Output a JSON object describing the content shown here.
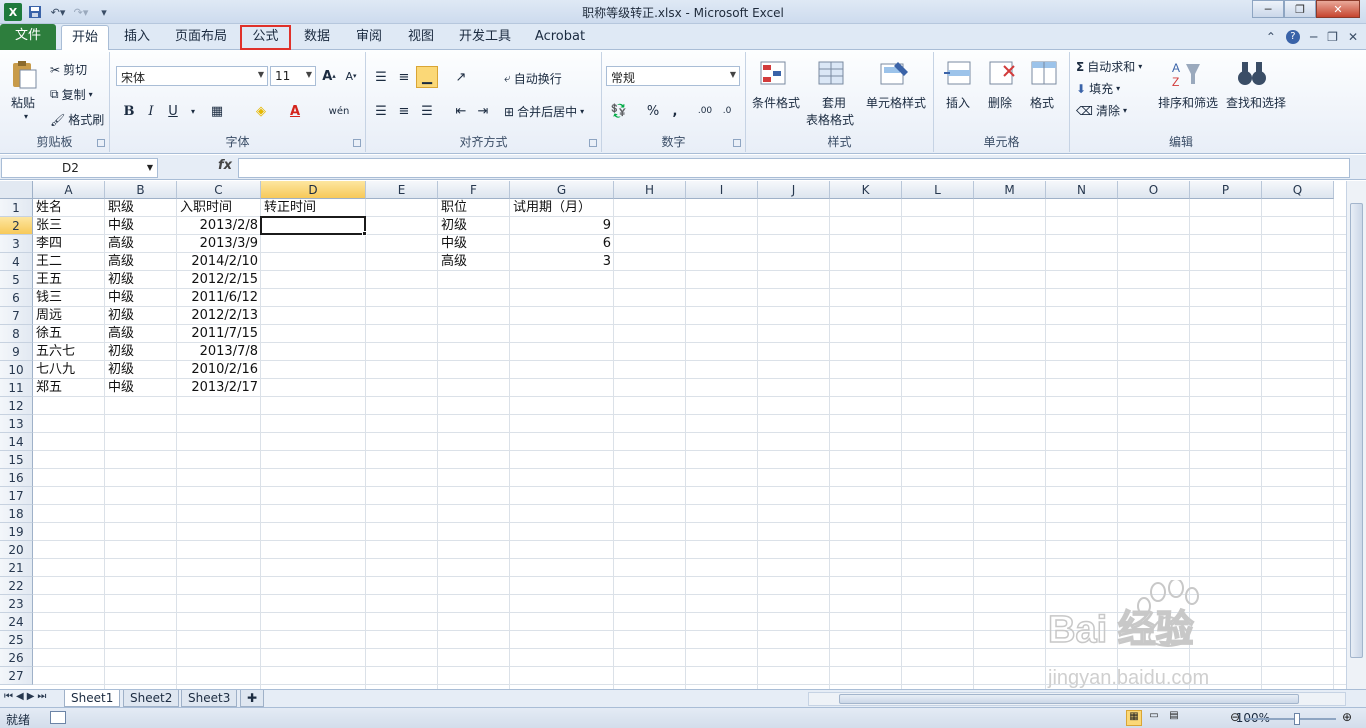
{
  "window": {
    "title": "职称等级转正.xlsx - Microsoft Excel"
  },
  "tabs": [
    "文件",
    "开始",
    "插入",
    "页面布局",
    "公式",
    "数据",
    "审阅",
    "视图",
    "开发工具",
    "Acrobat"
  ],
  "ribbon": {
    "clipboard": {
      "label": "剪贴板",
      "paste": "粘贴",
      "cut": "剪切",
      "copy": "复制",
      "format_painter": "格式刷"
    },
    "font": {
      "label": "字体",
      "name": "宋体",
      "size": "11"
    },
    "alignment": {
      "label": "对齐方式",
      "wrap": "自动换行",
      "merge": "合并后居中"
    },
    "number": {
      "label": "数字",
      "format": "常规"
    },
    "styles": {
      "label": "样式",
      "conditional": "条件格式",
      "table_line1": "套用",
      "table_line2": "表格格式",
      "cell_styles": "单元格样式"
    },
    "cells": {
      "label": "单元格",
      "insert": "插入",
      "delete": "删除",
      "format": "格式"
    },
    "editing": {
      "label": "编辑",
      "autosum": "自动求和",
      "fill": "填充",
      "clear": "清除",
      "sort": "排序和筛选",
      "find": "查找和选择"
    }
  },
  "formula_bar": {
    "name_box": "D2",
    "fx": "fx",
    "value": ""
  },
  "columns": [
    "A",
    "B",
    "C",
    "D",
    "E",
    "F",
    "G",
    "H",
    "I",
    "J",
    "K",
    "L",
    "M",
    "N",
    "O",
    "P",
    "Q"
  ],
  "rows": [
    "1",
    "2",
    "3",
    "4",
    "5",
    "6",
    "7",
    "8",
    "9",
    "10",
    "11",
    "12",
    "13",
    "14",
    "15",
    "16",
    "17",
    "18",
    "19",
    "20",
    "21",
    "22",
    "23",
    "24",
    "25",
    "26",
    "27"
  ],
  "table": {
    "headers": [
      "姓名",
      "职级",
      "入职时间",
      "转正时间"
    ],
    "records": [
      {
        "name": "张三",
        "level": "中级",
        "date": "2013/2/8"
      },
      {
        "name": "李四",
        "level": "高级",
        "date": "2013/3/9"
      },
      {
        "name": "王二",
        "level": "高级",
        "date": "2014/2/10"
      },
      {
        "name": "王五",
        "level": "初级",
        "date": "2012/2/15"
      },
      {
        "name": "钱三",
        "level": "中级",
        "date": "2011/6/12"
      },
      {
        "name": "周远",
        "level": "初级",
        "date": "2012/2/13"
      },
      {
        "name": "徐五",
        "level": "高级",
        "date": "2011/7/15"
      },
      {
        "name": "五六七",
        "level": "初级",
        "date": "2013/7/8"
      },
      {
        "name": "七八九",
        "level": "初级",
        "date": "2010/2/16"
      },
      {
        "name": "郑五",
        "level": "中级",
        "date": "2013/2/17"
      }
    ]
  },
  "lookup": {
    "headers": [
      "职位",
      "试用期（月）"
    ],
    "records": [
      {
        "level": "初级",
        "months": "9"
      },
      {
        "level": "中级",
        "months": "6"
      },
      {
        "level": "高级",
        "months": "3"
      }
    ]
  },
  "sheets": [
    "Sheet1",
    "Sheet2",
    "Sheet3"
  ],
  "status": {
    "ready": "就绪",
    "zoom": "100%"
  },
  "watermark": {
    "brand": "Bai 经验",
    "url": "jingyan.baidu.com"
  }
}
